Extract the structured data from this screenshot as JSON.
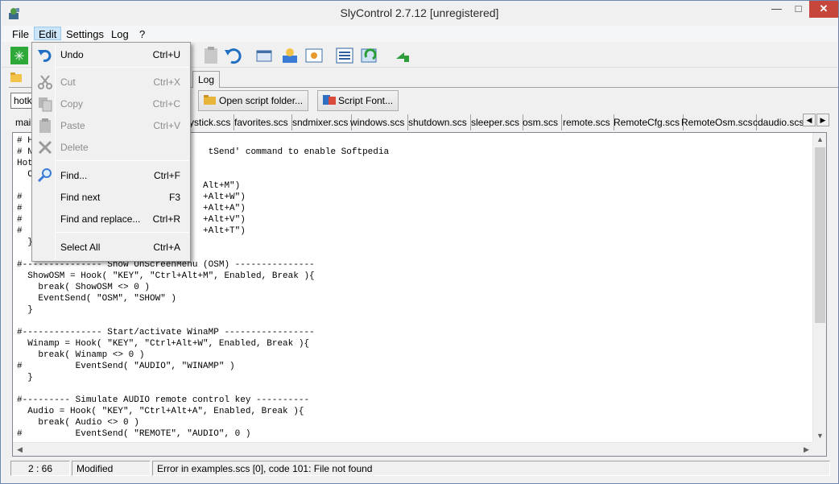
{
  "window": {
    "title": "SlyControl 2.7.12 [unregistered]"
  },
  "menubar": {
    "items": [
      "File",
      "Edit",
      "Settings",
      "Log",
      "?"
    ]
  },
  "edit_menu": {
    "items": [
      {
        "label": "Undo",
        "shortcut": "Ctrl+U",
        "enabled": true
      },
      {
        "label": "Cut",
        "shortcut": "Ctrl+X",
        "enabled": false
      },
      {
        "label": "Copy",
        "shortcut": "Ctrl+C",
        "enabled": false
      },
      {
        "label": "Paste",
        "shortcut": "Ctrl+V",
        "enabled": false
      },
      {
        "label": "Delete",
        "shortcut": "",
        "enabled": false
      },
      {
        "label": "Find...",
        "shortcut": "Ctrl+F",
        "enabled": true
      },
      {
        "label": "Find next",
        "shortcut": "F3",
        "enabled": true
      },
      {
        "label": "Find and replace...",
        "shortcut": "Ctrl+R",
        "enabled": true
      },
      {
        "label": "Select All",
        "shortcut": "Ctrl+A",
        "enabled": true
      }
    ]
  },
  "toolbar": {
    "icons": [
      "green-star-icon",
      "undo-icon",
      "redo-icon",
      "window-icon",
      "user-card-icon",
      "image-icon",
      "list-icon",
      "refresh-icon",
      "green-arrow-icon"
    ]
  },
  "tabs": {
    "log_label": "Log"
  },
  "script_toolbar": {
    "hotkeys_value": "hotke",
    "open_folder_label": "Open script folder...",
    "script_font_label": "Script Font..."
  },
  "file_tabs": [
    "mai",
    "ystick.scs",
    "favorites.scs",
    "sndmixer.scs",
    "windows.scs",
    "shutdown.scs",
    "sleeper.scs",
    "osm.scs",
    "remote.scs",
    "RemoteCfg.scs",
    "RemoteOsm.scs",
    "cdaudio.scs"
  ],
  "editor": {
    "code": "# H\n# N                                 tSend' command to enable Softpedia\nHot\n  C\n                                   Alt+M\")\n#                                  +Alt+W\")\n#                                  +Alt+A\")\n#                                  +Alt+V\")\n#                                  +Alt+T\")\n  }\n\n#--------------- Show OnScreenMenu (OSM) ---------------\n  ShowOSM = Hook( \"KEY\", \"Ctrl+Alt+M\", Enabled, Break ){\n    break( ShowOSM <> 0 )\n    EventSend( \"OSM\", \"SHOW\" )\n  }\n\n#--------------- Start/activate WinaMP -----------------\n  Winamp = Hook( \"KEY\", \"Ctrl+Alt+W\", Enabled, Break ){\n    break( Winamp <> 0 )\n#          EventSend( \"AUDIO\", \"WINAMP\" )\n  }\n\n#--------- Simulate AUDIO remote control key ----------\n  Audio = Hook( \"KEY\", \"Ctrl+Alt+A\", Enabled, Break ){\n    break( Audio <> 0 )\n#          EventSend( \"REMOTE\", \"AUDIO\", 0 )"
  },
  "statusbar": {
    "position": "2 : 66",
    "state": "Modified",
    "message": "Error in examples.scs [0], code 101: File not found"
  }
}
